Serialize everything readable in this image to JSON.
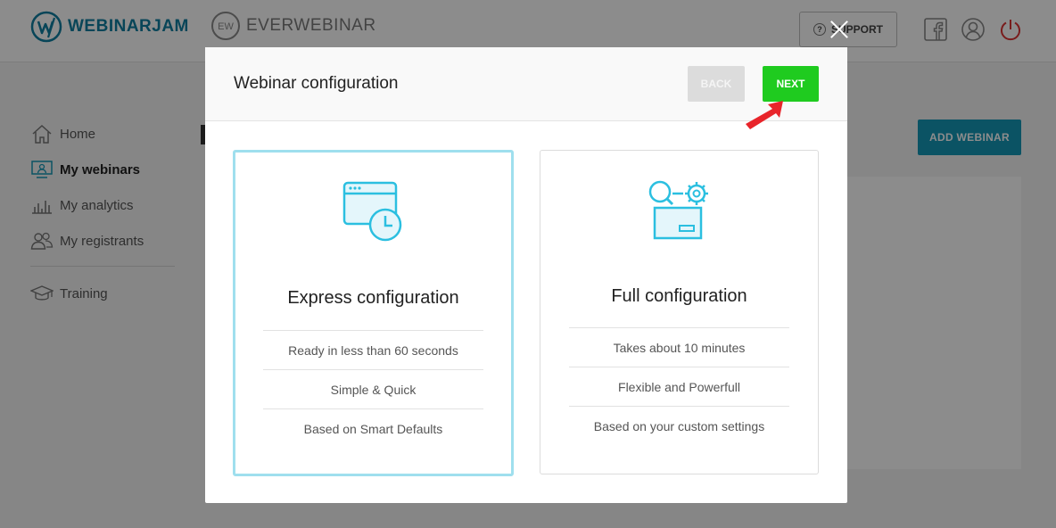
{
  "header": {
    "logo_primary": "WEBINARJAM",
    "logo_secondary": "EVERWEBINAR",
    "logo_secondary_badge": "EW",
    "support_label": "SUPPORT"
  },
  "sidebar": {
    "items": [
      {
        "label": "Home",
        "icon": "home-icon"
      },
      {
        "label": "My webinars",
        "icon": "monitor-icon"
      },
      {
        "label": "My analytics",
        "icon": "bar-chart-icon"
      },
      {
        "label": "My registrants",
        "icon": "users-icon"
      },
      {
        "label": "Training",
        "icon": "graduation-cap-icon"
      }
    ]
  },
  "main": {
    "add_webinar_label": "ADD WEBINAR"
  },
  "modal": {
    "title": "Webinar configuration",
    "back_label": "BACK",
    "next_label": "NEXT",
    "options": [
      {
        "title": "Express configuration",
        "icon": "browser-clock-icon",
        "features": [
          "Ready in less than 60 seconds",
          "Simple & Quick",
          "Based on Smart Defaults"
        ]
      },
      {
        "title": "Full configuration",
        "icon": "search-gear-box-icon",
        "features": [
          "Takes about 10 minutes",
          "Flexible and Powerfull",
          "Based on your custom settings"
        ]
      }
    ]
  },
  "colors": {
    "accent_blue": "#1497b7",
    "next_green": "#1fcb1f",
    "icon_cyan": "#2bbfe0",
    "selected_border": "#9fdfee",
    "arrow_red": "#e8242a"
  }
}
